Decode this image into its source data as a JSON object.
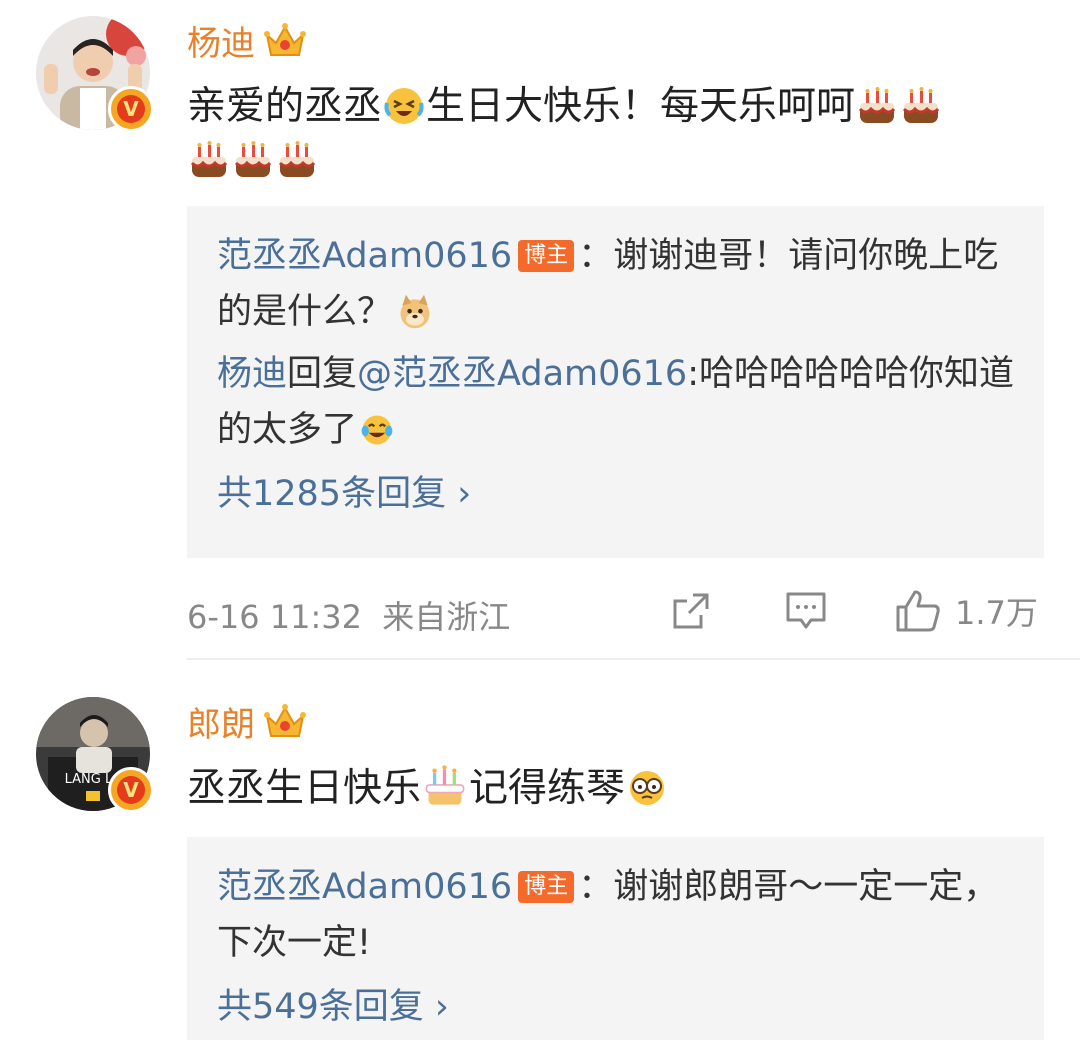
{
  "comments": [
    {
      "username": "杨迪",
      "text_parts": [
        "亲爱的丞丞",
        "生日大快乐！每天乐呵呵"
      ],
      "emoji_names": [
        "laughing-crying-emoji",
        "cake-emoji",
        "cake-emoji",
        "cake-emoji",
        "cake-emoji",
        "cake-emoji"
      ],
      "replies": [
        {
          "author": "范丞丞Adam0616",
          "badge": "博主",
          "text": "：谢谢迪哥！请问你晚上吃的是什么？"
        },
        {
          "author": "杨迪",
          "reply_word": "回复",
          "mention": "@范丞丞Adam0616",
          "text": ":哈哈哈哈哈哈你知道的太多了"
        }
      ],
      "more_replies": "共1285条回复 ›",
      "time": "6-16 11:32",
      "location": "来自浙江",
      "likes": "1.7万"
    },
    {
      "username": "郎朗",
      "text_parts": [
        "丞丞生日快乐",
        "记得练琴"
      ],
      "replies": [
        {
          "author": "范丞丞Adam0616",
          "badge": "博主",
          "text": "：谢谢郎朗哥～一定一定，下次一定!"
        }
      ],
      "more_replies": "共549条回复 ›"
    }
  ],
  "colors": {
    "username": "#e8812a",
    "link": "#4a6f98",
    "badge": "#f36a2b",
    "reply_bg": "#f4f4f4",
    "meta": "#888888"
  },
  "icons": [
    "share-icon",
    "comment-icon",
    "like-icon",
    "crown-icon",
    "verified-v-icon"
  ]
}
